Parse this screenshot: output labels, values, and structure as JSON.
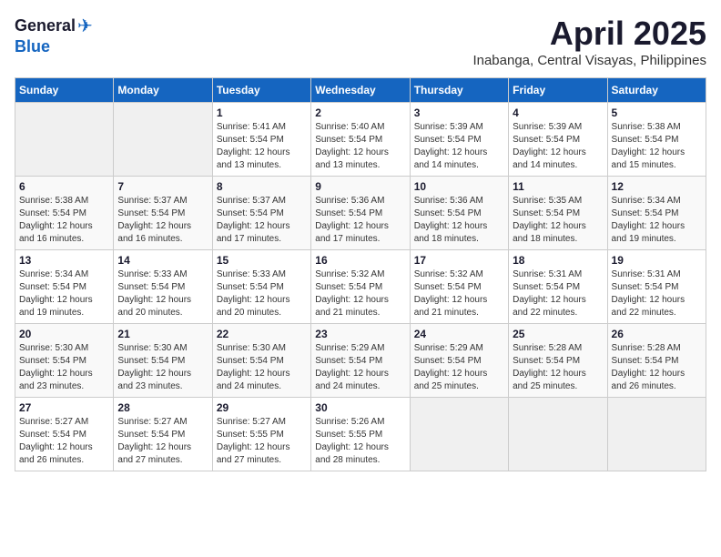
{
  "header": {
    "logo_general": "General",
    "logo_blue": "Blue",
    "month_title": "April 2025",
    "subtitle": "Inabanga, Central Visayas, Philippines"
  },
  "weekdays": [
    "Sunday",
    "Monday",
    "Tuesday",
    "Wednesday",
    "Thursday",
    "Friday",
    "Saturday"
  ],
  "weeks": [
    [
      {
        "day": "",
        "info": ""
      },
      {
        "day": "",
        "info": ""
      },
      {
        "day": "1",
        "info": "Sunrise: 5:41 AM\nSunset: 5:54 PM\nDaylight: 12 hours\nand 13 minutes."
      },
      {
        "day": "2",
        "info": "Sunrise: 5:40 AM\nSunset: 5:54 PM\nDaylight: 12 hours\nand 13 minutes."
      },
      {
        "day": "3",
        "info": "Sunrise: 5:39 AM\nSunset: 5:54 PM\nDaylight: 12 hours\nand 14 minutes."
      },
      {
        "day": "4",
        "info": "Sunrise: 5:39 AM\nSunset: 5:54 PM\nDaylight: 12 hours\nand 14 minutes."
      },
      {
        "day": "5",
        "info": "Sunrise: 5:38 AM\nSunset: 5:54 PM\nDaylight: 12 hours\nand 15 minutes."
      }
    ],
    [
      {
        "day": "6",
        "info": "Sunrise: 5:38 AM\nSunset: 5:54 PM\nDaylight: 12 hours\nand 16 minutes."
      },
      {
        "day": "7",
        "info": "Sunrise: 5:37 AM\nSunset: 5:54 PM\nDaylight: 12 hours\nand 16 minutes."
      },
      {
        "day": "8",
        "info": "Sunrise: 5:37 AM\nSunset: 5:54 PM\nDaylight: 12 hours\nand 17 minutes."
      },
      {
        "day": "9",
        "info": "Sunrise: 5:36 AM\nSunset: 5:54 PM\nDaylight: 12 hours\nand 17 minutes."
      },
      {
        "day": "10",
        "info": "Sunrise: 5:36 AM\nSunset: 5:54 PM\nDaylight: 12 hours\nand 18 minutes."
      },
      {
        "day": "11",
        "info": "Sunrise: 5:35 AM\nSunset: 5:54 PM\nDaylight: 12 hours\nand 18 minutes."
      },
      {
        "day": "12",
        "info": "Sunrise: 5:34 AM\nSunset: 5:54 PM\nDaylight: 12 hours\nand 19 minutes."
      }
    ],
    [
      {
        "day": "13",
        "info": "Sunrise: 5:34 AM\nSunset: 5:54 PM\nDaylight: 12 hours\nand 19 minutes."
      },
      {
        "day": "14",
        "info": "Sunrise: 5:33 AM\nSunset: 5:54 PM\nDaylight: 12 hours\nand 20 minutes."
      },
      {
        "day": "15",
        "info": "Sunrise: 5:33 AM\nSunset: 5:54 PM\nDaylight: 12 hours\nand 20 minutes."
      },
      {
        "day": "16",
        "info": "Sunrise: 5:32 AM\nSunset: 5:54 PM\nDaylight: 12 hours\nand 21 minutes."
      },
      {
        "day": "17",
        "info": "Sunrise: 5:32 AM\nSunset: 5:54 PM\nDaylight: 12 hours\nand 21 minutes."
      },
      {
        "day": "18",
        "info": "Sunrise: 5:31 AM\nSunset: 5:54 PM\nDaylight: 12 hours\nand 22 minutes."
      },
      {
        "day": "19",
        "info": "Sunrise: 5:31 AM\nSunset: 5:54 PM\nDaylight: 12 hours\nand 22 minutes."
      }
    ],
    [
      {
        "day": "20",
        "info": "Sunrise: 5:30 AM\nSunset: 5:54 PM\nDaylight: 12 hours\nand 23 minutes."
      },
      {
        "day": "21",
        "info": "Sunrise: 5:30 AM\nSunset: 5:54 PM\nDaylight: 12 hours\nand 23 minutes."
      },
      {
        "day": "22",
        "info": "Sunrise: 5:30 AM\nSunset: 5:54 PM\nDaylight: 12 hours\nand 24 minutes."
      },
      {
        "day": "23",
        "info": "Sunrise: 5:29 AM\nSunset: 5:54 PM\nDaylight: 12 hours\nand 24 minutes."
      },
      {
        "day": "24",
        "info": "Sunrise: 5:29 AM\nSunset: 5:54 PM\nDaylight: 12 hours\nand 25 minutes."
      },
      {
        "day": "25",
        "info": "Sunrise: 5:28 AM\nSunset: 5:54 PM\nDaylight: 12 hours\nand 25 minutes."
      },
      {
        "day": "26",
        "info": "Sunrise: 5:28 AM\nSunset: 5:54 PM\nDaylight: 12 hours\nand 26 minutes."
      }
    ],
    [
      {
        "day": "27",
        "info": "Sunrise: 5:27 AM\nSunset: 5:54 PM\nDaylight: 12 hours\nand 26 minutes."
      },
      {
        "day": "28",
        "info": "Sunrise: 5:27 AM\nSunset: 5:54 PM\nDaylight: 12 hours\nand 27 minutes."
      },
      {
        "day": "29",
        "info": "Sunrise: 5:27 AM\nSunset: 5:55 PM\nDaylight: 12 hours\nand 27 minutes."
      },
      {
        "day": "30",
        "info": "Sunrise: 5:26 AM\nSunset: 5:55 PM\nDaylight: 12 hours\nand 28 minutes."
      },
      {
        "day": "",
        "info": ""
      },
      {
        "day": "",
        "info": ""
      },
      {
        "day": "",
        "info": ""
      }
    ]
  ]
}
